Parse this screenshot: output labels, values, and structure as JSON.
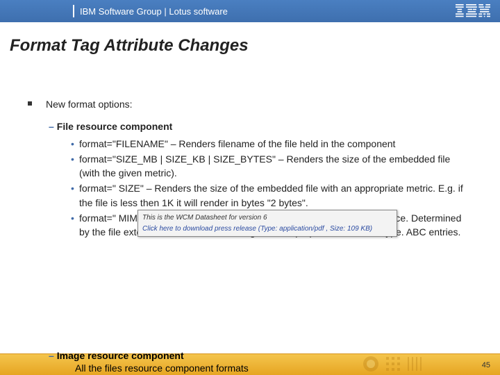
{
  "header": {
    "group": "IBM Software Group | Lotus software",
    "logo_alt": "IBM"
  },
  "title": "Format Tag Attribute Changes",
  "bullet_main": "New format options:",
  "section1": {
    "heading": "File resource component",
    "items": [
      "format=\"FILENAME\" – Renders filename of the file held in the component",
      "format=\"SIZE_MB | SIZE_KB | SIZE_BYTES\" – Renders the size of the embedded file (with the given metric).",
      "format=\" SIZE\" – Renders the size of the embedded file with an appropriate metric. E.g. if the file is less then 1K it will render in bytes \"2 bytes\".",
      "format=\" MIME_TYPE\" – Renders the mime type of the embedded resource. Determined by the file extension and the WCMConfigServices.properties extensiontype. ABC entries."
    ]
  },
  "popup": {
    "title": "This is the WCM Datasheet for version 6",
    "line": "Click here to download press release (Type: application/pdf , Size: 109 KB)"
  },
  "section2": {
    "heading": "Image resource component",
    "partial_line": "All the files resource component formats"
  },
  "page_number": "45"
}
